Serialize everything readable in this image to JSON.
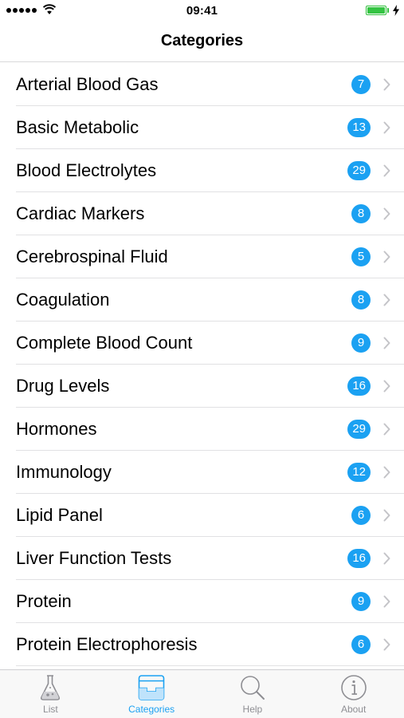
{
  "status_bar": {
    "time": "09:41",
    "signal_icon": "signal-dots-icon",
    "wifi_icon": "wifi-icon",
    "battery_icon": "battery-icon",
    "charging_icon": "charging-bolt-icon",
    "battery_color": "#35c443"
  },
  "nav": {
    "title": "Categories"
  },
  "colors": {
    "accent": "#1ba1f2",
    "inactive": "#8e8e93"
  },
  "categories": [
    {
      "label": "Arterial Blood Gas",
      "count": "7"
    },
    {
      "label": "Basic Metabolic",
      "count": "13"
    },
    {
      "label": "Blood Electrolytes",
      "count": "29"
    },
    {
      "label": "Cardiac Markers",
      "count": "8"
    },
    {
      "label": "Cerebrospinal Fluid",
      "count": "5"
    },
    {
      "label": "Coagulation",
      "count": "8"
    },
    {
      "label": "Complete Blood Count",
      "count": "9"
    },
    {
      "label": "Drug Levels",
      "count": "16"
    },
    {
      "label": "Hormones",
      "count": "29"
    },
    {
      "label": "Immunology",
      "count": "12"
    },
    {
      "label": "Lipid Panel",
      "count": "6"
    },
    {
      "label": "Liver Function Tests",
      "count": "16"
    },
    {
      "label": "Protein",
      "count": "9"
    },
    {
      "label": "Protein Electrophoresis",
      "count": "6"
    }
  ],
  "tabs": [
    {
      "label": "List",
      "icon": "flask-icon",
      "active": false
    },
    {
      "label": "Categories",
      "icon": "tray-icon",
      "active": true
    },
    {
      "label": "Help",
      "icon": "magnifier-icon",
      "active": false
    },
    {
      "label": "About",
      "icon": "info-icon",
      "active": false
    }
  ]
}
